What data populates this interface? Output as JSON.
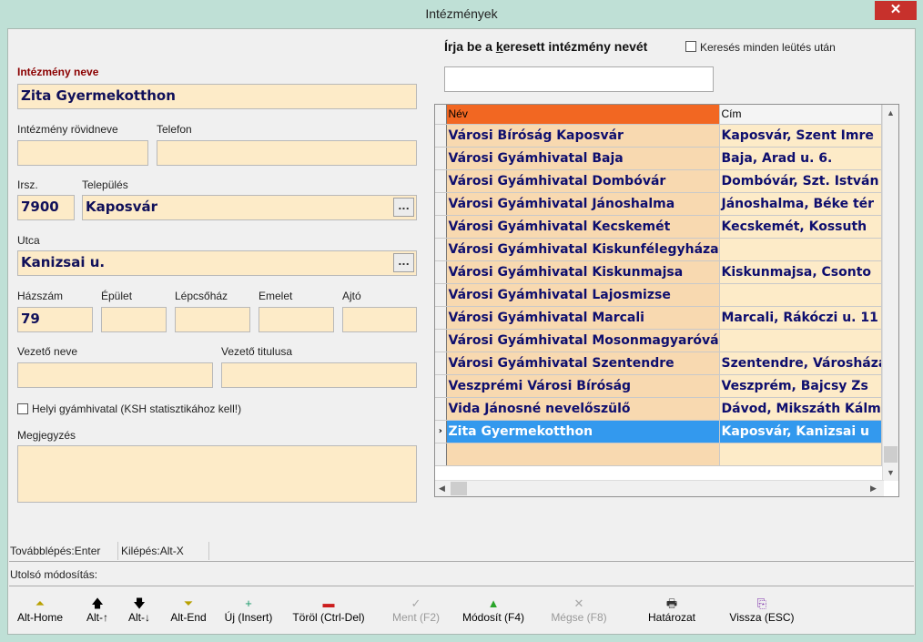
{
  "window": {
    "title": "Intézmények",
    "close_glyph": "✕"
  },
  "form": {
    "intezmeny_neve": {
      "label": "Intézmény neve",
      "value": "Zita Gyermekotthon"
    },
    "rovidnev": {
      "label": "Intézmény rövidneve",
      "value": ""
    },
    "telefon": {
      "label": "Telefon",
      "value": ""
    },
    "irsz": {
      "label": "Irsz.",
      "value": "7900"
    },
    "telepules": {
      "label": "Település",
      "value": "Kaposvár"
    },
    "utca": {
      "label": "Utca",
      "value": "Kanizsai u."
    },
    "hazszam": {
      "label": "Házszám",
      "value": "79"
    },
    "epulet": {
      "label": "Épület",
      "value": ""
    },
    "lepcsohaz": {
      "label": "Lépcsőház",
      "value": ""
    },
    "emelet": {
      "label": "Emelet",
      "value": ""
    },
    "ajto": {
      "label": "Ajtó",
      "value": ""
    },
    "vezeto_neve": {
      "label": "Vezető neve",
      "value": ""
    },
    "vezeto_titulusa": {
      "label": "Vezető titulusa",
      "value": ""
    },
    "helyi_gyamhivatal": {
      "label": "Helyi gyámhivatal (KSH statisztikához kell!)",
      "checked": false
    },
    "megjegyzes": {
      "label": "Megjegyzés",
      "value": ""
    },
    "ellipsis": "..."
  },
  "search": {
    "label_pre": "Írja be a ",
    "label_k": "k",
    "label_post": "eresett intézmény nevét",
    "every_key_label": "Keresés minden leütés után",
    "every_key_checked": false,
    "value": ""
  },
  "grid": {
    "columns": [
      "Név",
      "Cím"
    ],
    "rows": [
      {
        "nev": "Városi Bíróság Kaposvár",
        "cim": "Kaposvár, Szent Imre"
      },
      {
        "nev": "Városi Gyámhivatal Baja",
        "cim": "Baja, Arad u. 6."
      },
      {
        "nev": "Városi Gyámhivatal Dombóvár",
        "cim": "Dombóvár, Szt. István"
      },
      {
        "nev": "Városi Gyámhivatal Jánoshalma",
        "cim": "Jánoshalma, Béke tér"
      },
      {
        "nev": "Városi Gyámhivatal Kecskemét",
        "cim": "Kecskemét, Kossuth"
      },
      {
        "nev": "Városi Gyámhivatal Kiskunfélegyháza",
        "cim": ""
      },
      {
        "nev": "Városi Gyámhivatal Kiskunmajsa",
        "cim": "Kiskunmajsa, Csonto"
      },
      {
        "nev": "Városi Gyámhivatal Lajosmizse",
        "cim": ""
      },
      {
        "nev": "Városi Gyámhivatal Marcali",
        "cim": "Marcali, Rákóczi u. 11"
      },
      {
        "nev": "Városi Gyámhivatal Mosonmagyaróvár",
        "cim": ""
      },
      {
        "nev": "Városi Gyámhivatal Szentendre",
        "cim": "Szentendre, Városháza"
      },
      {
        "nev": "Veszprémi Városi Bíróság",
        "cim": "Veszprém, Bajcsy Zs"
      },
      {
        "nev": "Vida Jánosné nevelőszülő",
        "cim": "Dávod, Mikszáth Kálm"
      },
      {
        "nev": "Zita Gyermekotthon",
        "cim": "Kaposvár, Kanizsai u"
      }
    ],
    "selected_index": 13,
    "row_marker": "›"
  },
  "status": {
    "tovabblepes": "Továbblépés:Enter",
    "kilepes": "Kilépés:Alt-X",
    "utolso_modositas": "Utolsó módosítás:"
  },
  "toolbar": {
    "buttons": [
      {
        "label": "Alt-Home",
        "icon": "first-record-icon",
        "glyph": "⏶",
        "enabled": true
      },
      {
        "label": "Alt-↑",
        "icon": "arrow-up-icon",
        "glyph": "🡅",
        "enabled": true
      },
      {
        "label": "Alt-↓",
        "icon": "arrow-down-icon",
        "glyph": "🡇",
        "enabled": true
      },
      {
        "label": "Alt-End",
        "icon": "last-record-icon",
        "glyph": "⏷",
        "enabled": true
      },
      {
        "label": "Új (Insert)",
        "icon": "plus-icon",
        "glyph": "+",
        "enabled": true
      },
      {
        "label": "Töröl (Ctrl-Del)",
        "icon": "minus-icon",
        "glyph": "▬",
        "enabled": true
      },
      {
        "label": "Ment (F2)",
        "icon": "check-icon",
        "glyph": "✓",
        "enabled": false
      },
      {
        "label": "Módosít (F4)",
        "icon": "triangle-up-icon",
        "glyph": "▲",
        "enabled": true
      },
      {
        "label": "Mégse (F8)",
        "icon": "cancel-icon",
        "glyph": "✕",
        "enabled": false
      },
      {
        "label": "Határozat",
        "icon": "printer-icon",
        "glyph": "🖶",
        "enabled": true
      },
      {
        "label": "Vissza (ESC)",
        "icon": "exit-door-icon",
        "glyph": "⎘",
        "enabled": true
      }
    ]
  },
  "colors": {
    "field_bg": "#fdebc8",
    "name_col_bg": "#f8d9b0",
    "header_accent": "#f26722",
    "selection": "#3399ee",
    "frame": "#bfe0d6",
    "close": "#c7312c"
  }
}
